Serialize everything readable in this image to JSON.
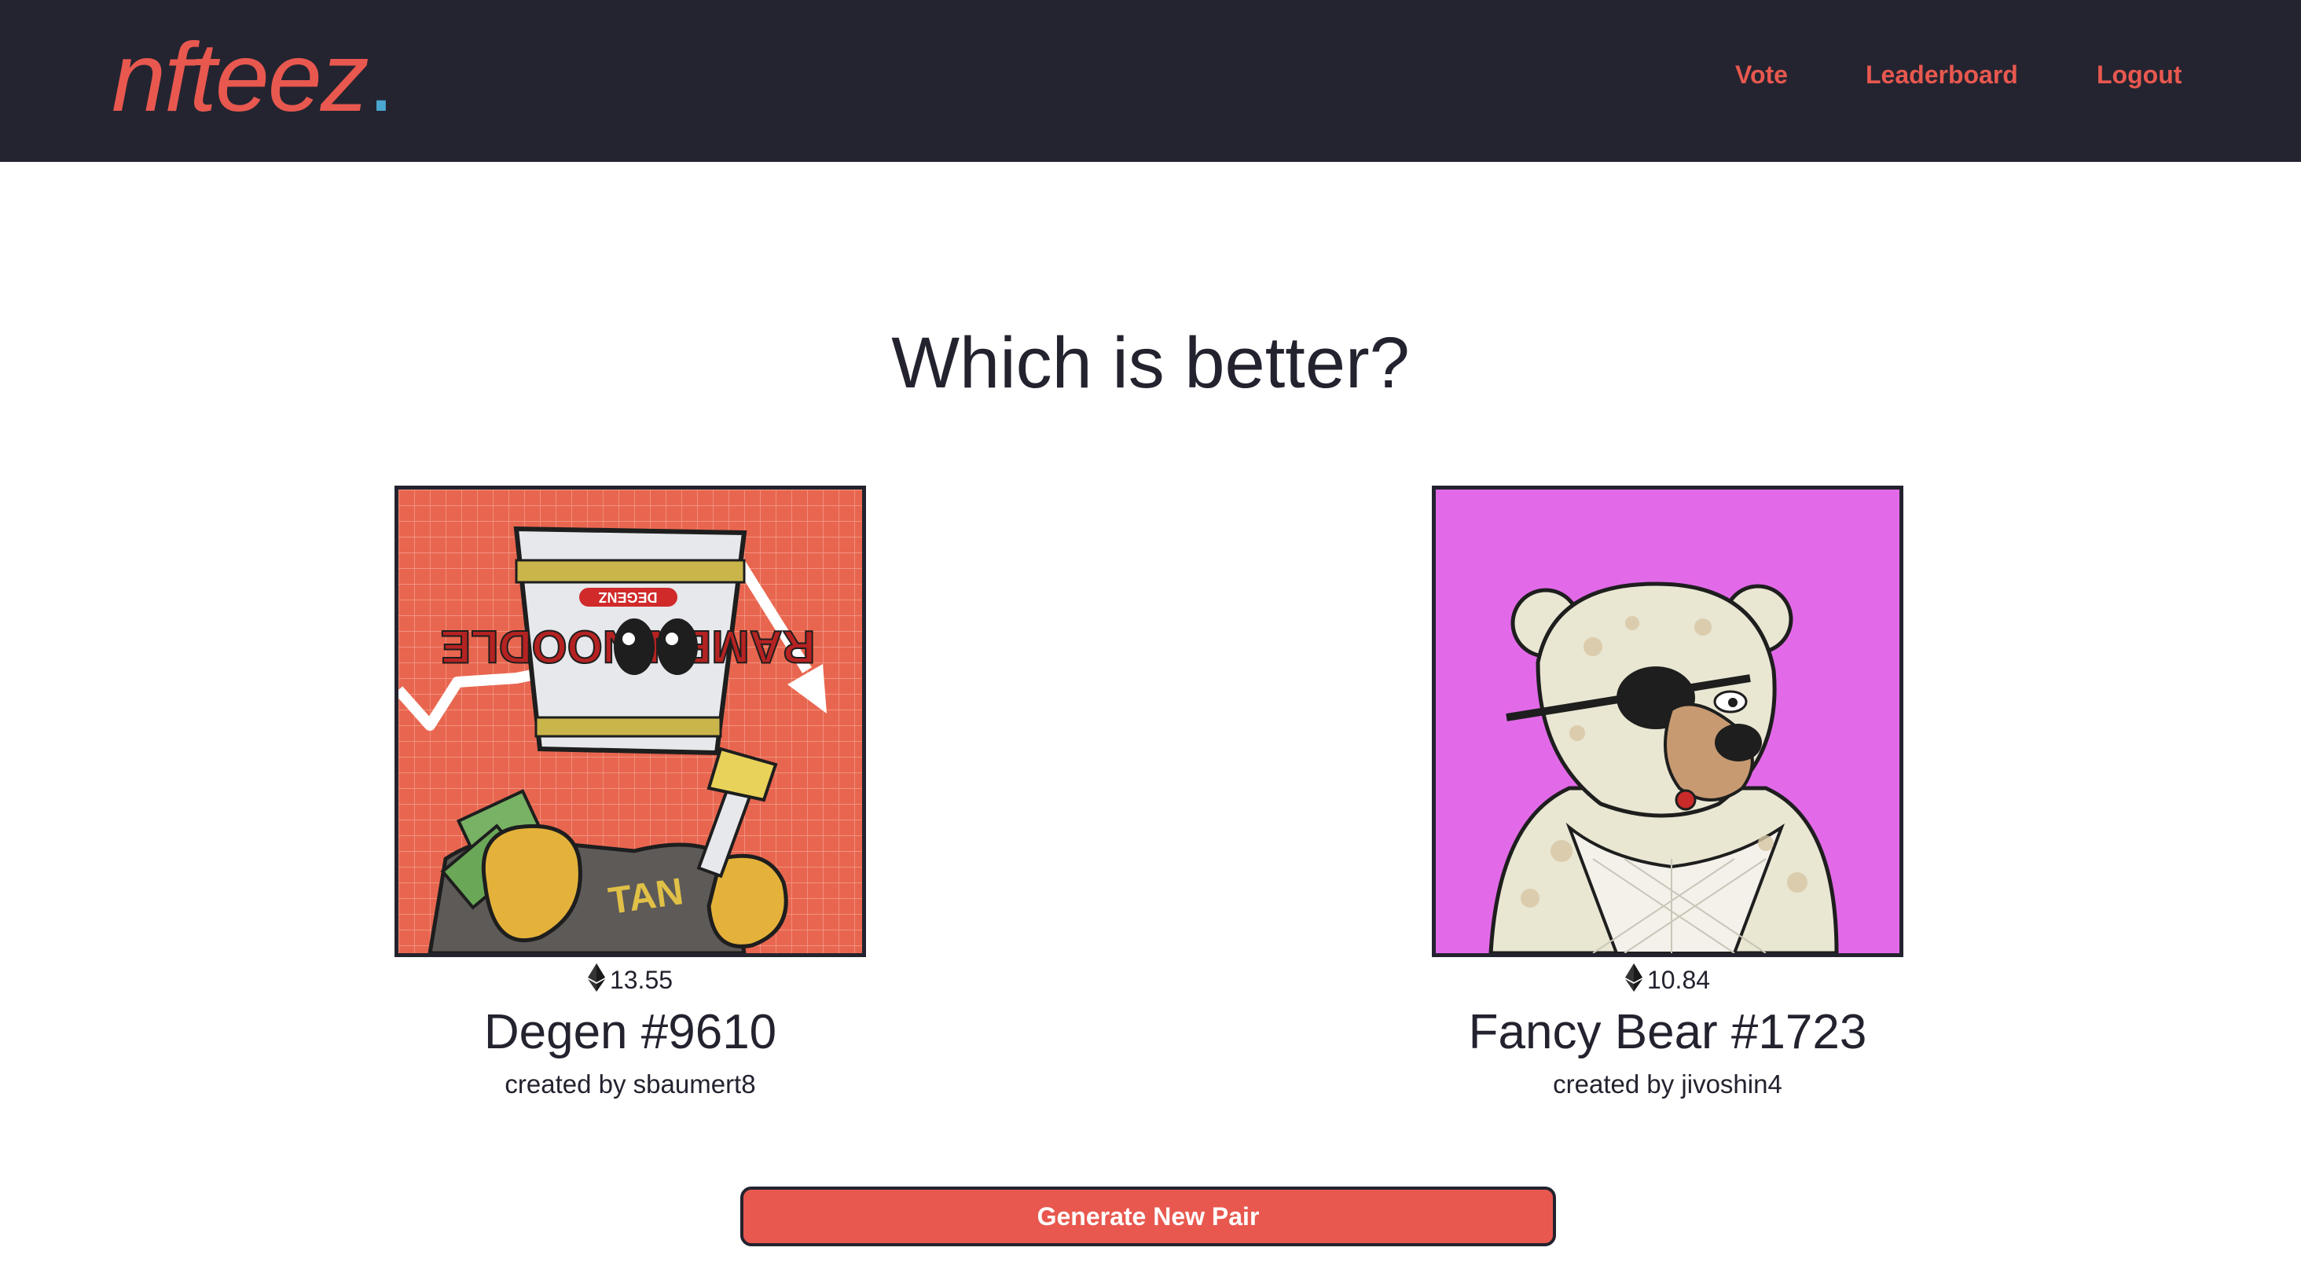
{
  "header": {
    "logo_text": "nfteez",
    "logo_dot": ".",
    "nav": {
      "vote": "Vote",
      "leaderboard": "Leaderboard",
      "logout": "Logout"
    }
  },
  "main": {
    "heading": "Which is better?",
    "cards": [
      {
        "price": "13.55",
        "name": "Degen #9610",
        "creator": "created by sbaumert8",
        "image_label": "RAMEN NOODLE",
        "image_sub_label": "DEGENZ",
        "shirt_text": "TAN"
      },
      {
        "price": "10.84",
        "name": "Fancy Bear #1723",
        "creator": "created by jivoshin4"
      }
    ],
    "generate_button": "Generate New Pair"
  },
  "colors": {
    "header_bg": "#242430",
    "accent": "#e8584f",
    "logo_dot": "#4aa8d0",
    "text": "#23232f",
    "left_image_bg": "#e8664f",
    "right_image_bg": "#e26ae8"
  },
  "icons": {
    "price": "ethereum-icon"
  }
}
